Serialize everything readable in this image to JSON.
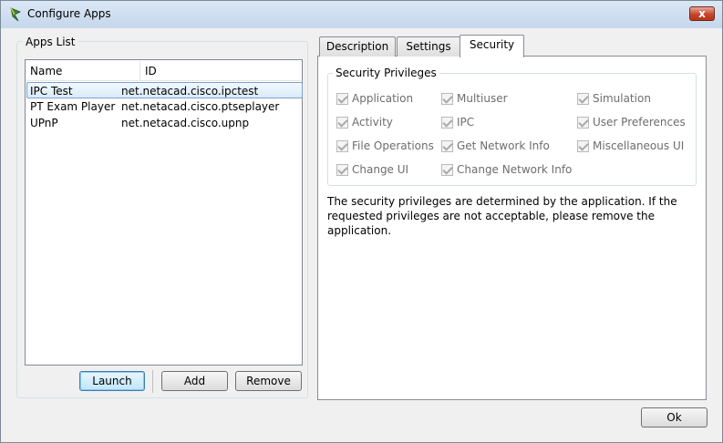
{
  "window": {
    "title": "Configure Apps",
    "close_glyph": "x"
  },
  "apps_list": {
    "label": "Apps List",
    "columns": [
      "Name",
      "ID"
    ],
    "rows": [
      {
        "name": "IPC Test",
        "id": "net.netacad.cisco.ipctest",
        "selected": true
      },
      {
        "name": "PT Exam Player",
        "id": "net.netacad.cisco.ptseplayer",
        "selected": false
      },
      {
        "name": "UPnP",
        "id": "net.netacad.cisco.upnp",
        "selected": false
      }
    ],
    "buttons": {
      "launch": "Launch",
      "add": "Add",
      "remove": "Remove"
    }
  },
  "tabs": [
    "Description",
    "Settings",
    "Security"
  ],
  "active_tab": "Security",
  "security": {
    "group_label": "Security Privileges",
    "privileges": [
      {
        "label": "Application",
        "checked": true,
        "enabled": false
      },
      {
        "label": "Multiuser",
        "checked": true,
        "enabled": false
      },
      {
        "label": "Simulation",
        "checked": true,
        "enabled": false
      },
      {
        "label": "Activity",
        "checked": true,
        "enabled": false
      },
      {
        "label": "IPC",
        "checked": true,
        "enabled": false
      },
      {
        "label": "User Preferences",
        "checked": true,
        "enabled": false
      },
      {
        "label": "File Operations",
        "checked": true,
        "enabled": false
      },
      {
        "label": "Get Network Info",
        "checked": true,
        "enabled": false
      },
      {
        "label": "Miscellaneous UI",
        "checked": true,
        "enabled": false
      },
      {
        "label": "Change UI",
        "checked": true,
        "enabled": false
      },
      {
        "label": "Change Network Info",
        "checked": true,
        "enabled": false
      }
    ],
    "description_lines": [
      "The security privileges are determined by the application. If the",
      "requested privileges are not acceptable, please remove the",
      "application."
    ]
  },
  "ok_label": "Ok",
  "colors": {
    "selection_border": "#7da2ce",
    "close_button": "#c8452c"
  }
}
